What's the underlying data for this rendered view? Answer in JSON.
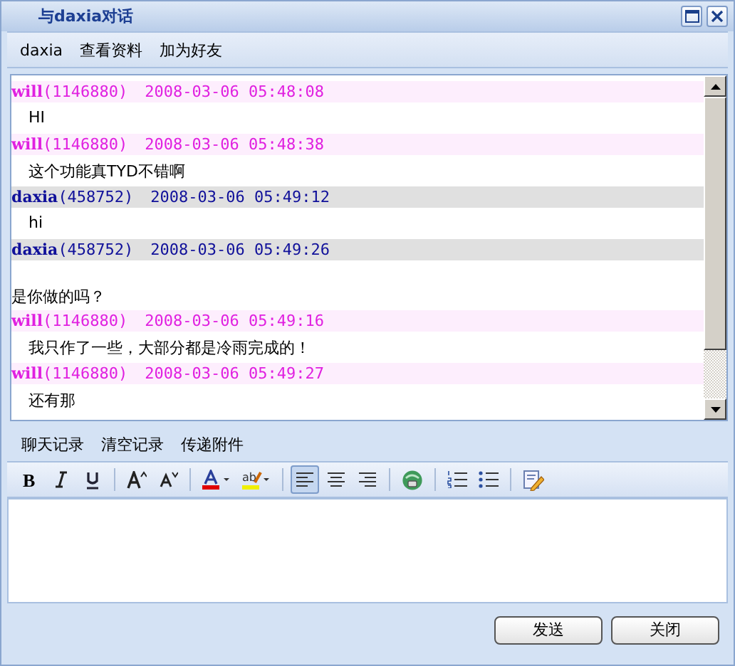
{
  "window": {
    "title": "与daxia对话"
  },
  "menu": [
    "daxia",
    "查看资料",
    "加为好友"
  ],
  "messages": [
    {
      "kind": "self",
      "name": "will",
      "id": "(1146880)",
      "time": "2008-03-06 05:48:08",
      "lines": [
        {
          "text": "HI",
          "indent": true
        }
      ]
    },
    {
      "kind": "self",
      "name": "will",
      "id": "(1146880)",
      "time": "2008-03-06 05:48:38",
      "lines": [
        {
          "text": "这个功能真TYD不错啊",
          "indent": true
        }
      ]
    },
    {
      "kind": "other",
      "name": "daxia",
      "id": "(458752)",
      "time": "2008-03-06 05:49:12",
      "lines": [
        {
          "text": "hi",
          "indent": true
        }
      ]
    },
    {
      "kind": "other",
      "name": "daxia",
      "id": "(458752)",
      "time": "2008-03-06 05:49:26",
      "lines": [
        {
          "text": "是你做的吗？",
          "indent": false
        }
      ]
    },
    {
      "kind": "self",
      "name": "will",
      "id": "(1146880)",
      "time": "2008-03-06 05:49:16",
      "lines": [
        {
          "text": "我只作了一些，大部分都是冷雨完成的！",
          "indent": true
        }
      ]
    },
    {
      "kind": "self",
      "name": "will",
      "id": "(1146880)",
      "time": "2008-03-06 05:49:27",
      "lines": [
        {
          "text": "还有那",
          "indent": true
        }
      ]
    }
  ],
  "actions": [
    "聊天记录",
    "清空记录",
    "传递附件"
  ],
  "format_tools": [
    {
      "kind": "bold",
      "label": "B",
      "selected": false
    },
    {
      "kind": "italic",
      "selected": false
    },
    {
      "kind": "underline",
      "selected": false
    },
    {
      "kind": "sep"
    },
    {
      "kind": "grow",
      "selected": false
    },
    {
      "kind": "shrink",
      "selected": false
    },
    {
      "kind": "sep"
    },
    {
      "kind": "color",
      "selected": false
    },
    {
      "kind": "highlight",
      "label": "ab",
      "selected": false
    },
    {
      "kind": "sep"
    },
    {
      "kind": "left",
      "selected": true
    },
    {
      "kind": "center",
      "selected": false
    },
    {
      "kind": "right",
      "selected": false
    },
    {
      "kind": "sep"
    },
    {
      "kind": "link",
      "selected": false
    },
    {
      "kind": "sep"
    },
    {
      "kind": "ol",
      "selected": false
    },
    {
      "kind": "ul",
      "selected": false
    },
    {
      "kind": "sep"
    },
    {
      "kind": "source",
      "selected": false
    }
  ],
  "buttons": [
    "发送",
    "关闭"
  ]
}
